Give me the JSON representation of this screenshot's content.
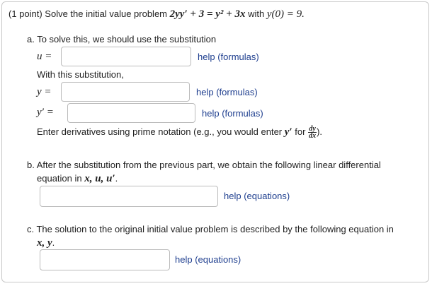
{
  "problem": {
    "prefix": "(1 point) Solve the initial value problem",
    "ode": "2yy′ + 3 = y² + 3x",
    "with_word": "with",
    "ic": "y(0) = 9."
  },
  "part_a": {
    "intro": "a. To solve this, we should use the substitution",
    "u_label": "u =",
    "u_help": "help (formulas)",
    "with_sub": "With this substitution,",
    "y_label": "y =",
    "y_help": "help (formulas)",
    "yprime_label": "y′ =",
    "yprime_help": "help (formulas)",
    "note_prefix": "Enter derivatives using prime notation (e.g., you would enter",
    "note_yprime": "y′",
    "note_for": "for",
    "note_frac_num": "dy",
    "note_frac_den": "dx",
    "note_suffix": ")."
  },
  "part_b": {
    "line1": "b. After the substitution from the previous part, we obtain the following linear differential",
    "line2_prefix": "equation in",
    "line2_vars": "x, u, u′",
    "line2_suffix": ".",
    "help": "help (equations)"
  },
  "part_c": {
    "line1": "c. The solution to the original initial value problem is described by the following equation in",
    "vars": "x, y",
    "suffix": ".",
    "help": "help (equations)"
  }
}
